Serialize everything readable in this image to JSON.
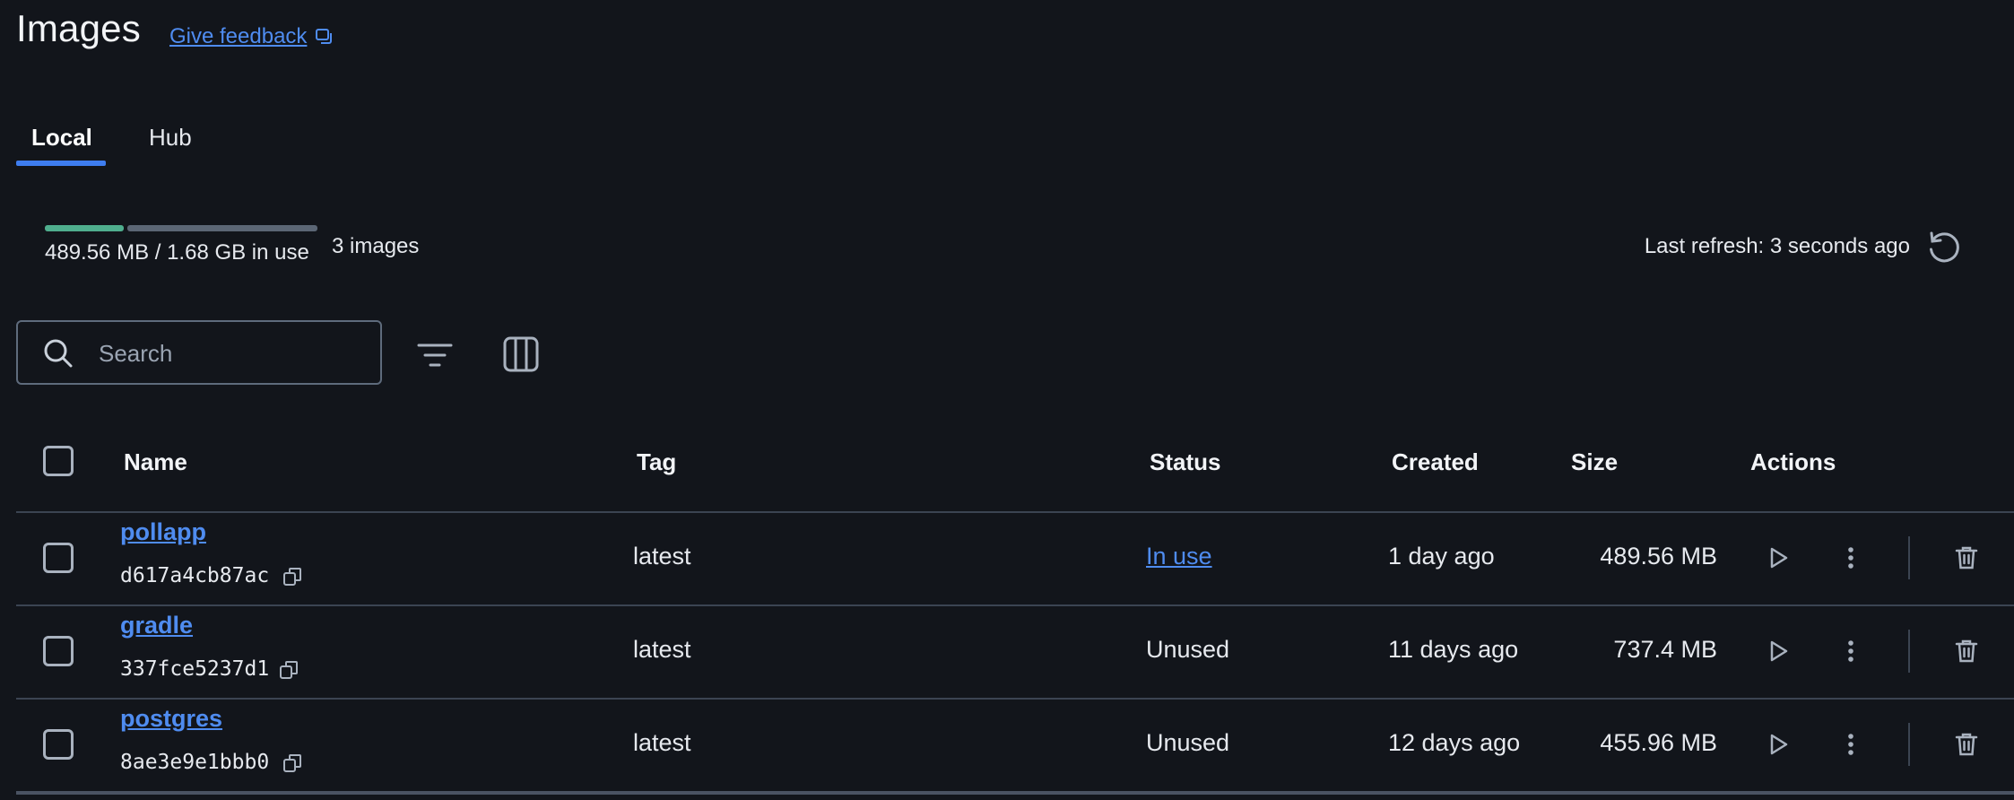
{
  "header": {
    "title": "Images",
    "feedback_label": "Give feedback"
  },
  "tabs": [
    {
      "label": "Local",
      "active": true
    },
    {
      "label": "Hub",
      "active": false
    }
  ],
  "usage": {
    "text": "489.56 MB / 1.68 GB in use",
    "used_fraction": 0.29,
    "images_count": "3 images",
    "last_refresh": "Last refresh: 3 seconds ago"
  },
  "toolbar": {
    "search_placeholder": "Search"
  },
  "table": {
    "headers": {
      "name": "Name",
      "tag": "Tag",
      "status": "Status",
      "created": "Created",
      "size": "Size",
      "actions": "Actions"
    },
    "rows": [
      {
        "name": "pollapp",
        "id": "d617a4cb87ac",
        "tag": "latest",
        "status": "In use",
        "created": "1 day ago",
        "size": "489.56 MB"
      },
      {
        "name": "gradle",
        "id": "337fce5237d1",
        "tag": "latest",
        "status": "Unused",
        "created": "11 days ago",
        "size": "737.4 MB"
      },
      {
        "name": "postgres",
        "id": "8ae3e9e1bbb0",
        "tag": "latest",
        "status": "Unused",
        "created": "12 days ago",
        "size": "455.96 MB"
      }
    ]
  },
  "colors": {
    "background": "#12151b",
    "accent": "#3e7df0",
    "link": "#4f8cf0",
    "usage_used": "#4fae8e",
    "usage_free": "#5b6675"
  }
}
